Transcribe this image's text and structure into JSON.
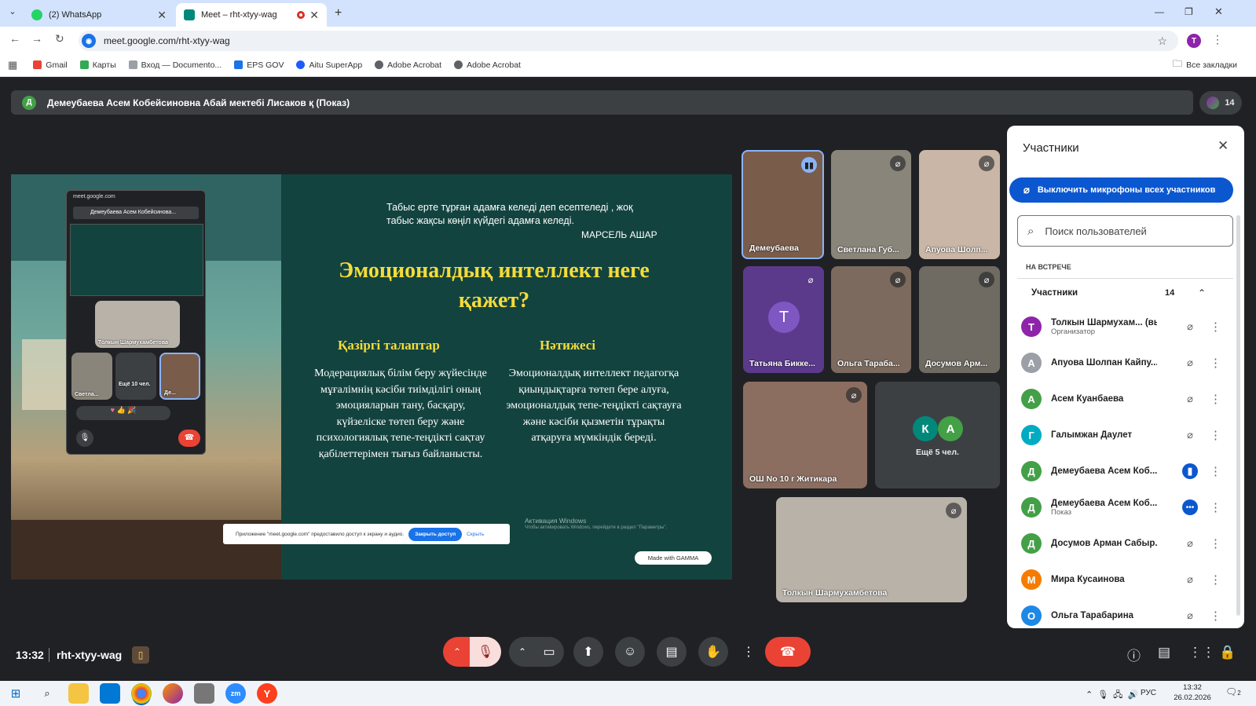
{
  "browser": {
    "tabs": [
      {
        "label": "(2) WhatsApp",
        "icon": "whatsapp-icon",
        "color": "#25d366"
      },
      {
        "label": "Meet – rht-xtyy-wag",
        "icon": "meet-icon",
        "color": "#00897b"
      }
    ],
    "url": "meet.google.com/rht-xtyy-wag",
    "profile_initial": "T",
    "bookmarks": [
      {
        "label": "Gmail",
        "color": "#ea4335"
      },
      {
        "label": "Карты",
        "color": "#34a853"
      },
      {
        "label": "Вход — Documento...",
        "color": "#9aa0a6"
      },
      {
        "label": "EPS GOV",
        "color": "#1a73e8"
      },
      {
        "label": "Aitu SuperApp",
        "color": "#1a5cff"
      },
      {
        "label": "Adobe Acrobat",
        "color": "#5f6368"
      },
      {
        "label": "Adobe Acrobat",
        "color": "#5f6368"
      }
    ],
    "all_bookmarks": "Все закладки"
  },
  "meet": {
    "presenter_initial": "Д",
    "presenter_bar": "Демеубаева Асем Кобейсиновна Абай мектебі Лисаков қ (Показ)",
    "participant_count": "14",
    "time": "13:32",
    "meeting_code": "rht-xtyy-wag"
  },
  "slide": {
    "quote": "Табыс ерте тұрған адамға келеді деп есептеледі , жоқ табыс жақсы көңіл күйдегі адамға келеді.",
    "author": "МАРСЕЛЬ АШАР",
    "title": "Эмоционалдық интеллект неге қажет?",
    "col1_head": "Қазіргі талаптар",
    "col1_text": "Модерациялық білім беру жүйесінде мұғалімнің кәсіби тиімділігі оның эмоцияларын тану, басқару, күйзеліске төтеп беру және психологиялық тепе-теңдікті сақтау қабілеттерімен тығыз байланысты.",
    "col2_head": "Нәтижесі",
    "col2_text": "Эмоционалдық интеллект педагогқа қиындықтарға төтеп бере алуға, эмоционалдық тепе-теңдікті сақтауға және кәсіби қызметін тұрақты атқаруға мүмкіндік береді.",
    "mini_url": "meet.google.com",
    "mini_bar": "Демеубаева Асем Кобейсинова...",
    "mini_tile_name": "Толкын Шармухамбетова",
    "mini_svetl": "Светла...",
    "mini_more": "Ещё 10 чел.",
    "mini_de": "Де...",
    "share_notice": "Приложение \"meet.google.com\" предоставило доступ к экрану и аудио.",
    "share_stop": "Закрыть доступ",
    "share_hide": "Скрыть",
    "win_act": "Активация Windows",
    "win_act_sub": "Чтобы активировать Windows, перейдите в раздел \"Параметры\".",
    "made_with": "Made with GAMMA"
  },
  "tiles": [
    {
      "name": "Демеубаева",
      "color": "#7a5c4a"
    },
    {
      "name": "Светлана Губ...",
      "color": "#8a857a"
    },
    {
      "name": "Апуова Шолп...",
      "color": "#c9b6a6"
    },
    {
      "name": "Татьяна Бикке...",
      "initial": "Т",
      "color": "#5b3a8c"
    },
    {
      "name": "Ольга Тараба...",
      "color": "#7c6a5e"
    },
    {
      "name": "Досумов Арм...",
      "color": "#6f6b62"
    },
    {
      "name": "ОШ No 10 г Житикара",
      "color": "#8b6e60"
    },
    {
      "name": "Ещё 5 чел.",
      "initials": [
        "К",
        "А"
      ],
      "color": "#3c4043"
    },
    {
      "name": "Толкын Шармухамбетова",
      "color": "#b8b2a8"
    }
  ],
  "panel": {
    "title": "Участники",
    "mute_all": "Выключить микрофоны всех участников",
    "search_placeholder": "Поиск пользователей",
    "section": "НА ВСТРЕЧЕ",
    "group_label": "Участники",
    "group_count": "14",
    "people": [
      {
        "initial": "Т",
        "name": "Толкын Шармухам... (вы)",
        "sub": "Организатор",
        "color": "#8e24aa",
        "mic": "mic-off-icon"
      },
      {
        "initial": "А",
        "name": "Апуова Шолпан Кайпу...",
        "sub": "",
        "color": "#9aa0a6",
        "mic": "mic-off-icon"
      },
      {
        "initial": "А",
        "name": "Асем Куанбаева",
        "sub": "",
        "color": "#43a047",
        "mic": "mic-off-icon"
      },
      {
        "initial": "Г",
        "name": "Галымжан Даулет",
        "sub": "",
        "color": "#00acc1",
        "mic": "mic-off-icon"
      },
      {
        "initial": "Д",
        "name": "Демеубаева Асем Коб...",
        "sub": "",
        "color": "#43a047",
        "mic": "speaking-icon"
      },
      {
        "initial": "Д",
        "name": "Демеубаева Асем Коб...",
        "sub": "Показ",
        "color": "#43a047",
        "mic": "more-indicator-icon"
      },
      {
        "initial": "Д",
        "name": "Досумов Арман Сабыр...",
        "sub": "",
        "color": "#43a047",
        "mic": "mic-off-icon"
      },
      {
        "initial": "М",
        "name": "Мира Кусаинова",
        "sub": "",
        "color": "#f57c00",
        "mic": "mic-off-icon"
      },
      {
        "initial": "О",
        "name": "Ольга Тарабарина",
        "sub": "",
        "color": "#1e88e5",
        "mic": "mic-off-icon"
      }
    ]
  },
  "taskbar": {
    "lang": "РУС",
    "time": "13:32",
    "date": "26.02.2026",
    "notif": "2"
  }
}
